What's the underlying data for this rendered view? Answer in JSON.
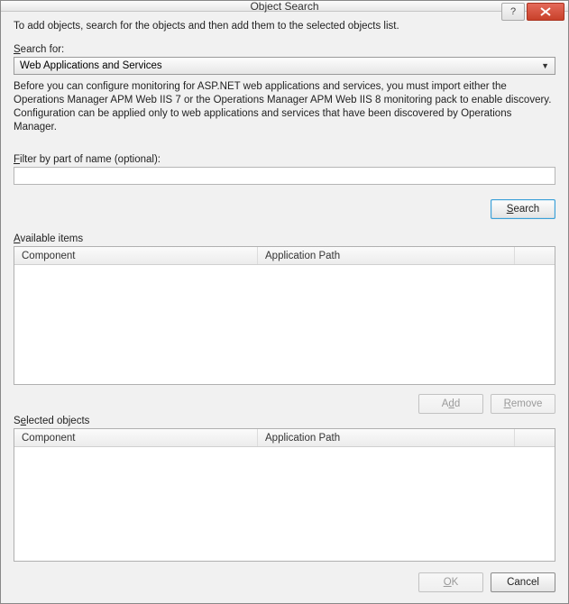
{
  "title": "Object Search",
  "instruction": "To add objects, search for the objects and then add them to the selected objects list.",
  "searchFor": {
    "label": "Search for:",
    "selected": "Web Applications and Services"
  },
  "helpText": "Before you can configure monitoring for ASP.NET web applications and services, you must import either the Operations Manager APM Web IIS 7 or the Operations Manager APM Web IIS 8 monitoring pack to enable discovery. Configuration can be applied only to web applications and services that have been discovered by Operations Manager.",
  "filter": {
    "label": "Filter by part of name (optional):",
    "value": ""
  },
  "buttons": {
    "search": "Search",
    "add": "Add",
    "remove": "Remove",
    "ok": "OK",
    "cancel": "Cancel"
  },
  "available": {
    "title": "Available items",
    "columns": {
      "component": "Component",
      "appPath": "Application Path"
    }
  },
  "selected": {
    "title": "Selected objects",
    "columns": {
      "component": "Component",
      "appPath": "Application Path"
    }
  }
}
